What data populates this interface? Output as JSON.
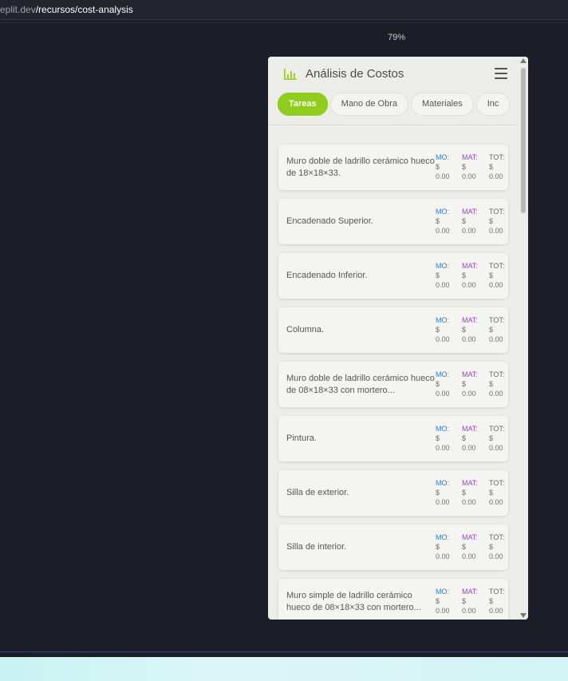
{
  "browser": {
    "url_host": "eplit.dev",
    "url_path": "/recursos/cost-analysis",
    "zoom": "79%"
  },
  "colors": {
    "accent": "#8fcc1c",
    "mo": "#2c7cf0",
    "mat": "#9b3ee0"
  },
  "app": {
    "title": "Análisis de Costos",
    "logo_icon": "bar-chart-icon",
    "menu_icon": "hamburger-menu-icon",
    "tabs": [
      {
        "label": "Tareas",
        "active": true
      },
      {
        "label": "Mano de Obra"
      },
      {
        "label": "Materiales"
      },
      {
        "label": "Inc"
      }
    ]
  },
  "labels": {
    "mo": "MO:",
    "mat": "MAT:",
    "tot": "TOT:",
    "currency": "$"
  },
  "tasks": [
    {
      "name": "Muro doble de ladrillo cerámico hueco de 18×18×33.",
      "mo": "0.00",
      "mat": "0.00",
      "tot": "0.00"
    },
    {
      "name": "Encadenado Superior.",
      "mo": "0.00",
      "mat": "0.00",
      "tot": "0.00"
    },
    {
      "name": "Encadenado Inferior.",
      "mo": "0.00",
      "mat": "0.00",
      "tot": "0.00"
    },
    {
      "name": "Columna.",
      "mo": "0.00",
      "mat": "0.00",
      "tot": "0.00"
    },
    {
      "name": "Muro doble de ladrillo cerámico hueco de 08×18×33 con mortero...",
      "mo": "0.00",
      "mat": "0.00",
      "tot": "0.00"
    },
    {
      "name": "Pintura.",
      "mo": "0.00",
      "mat": "0.00",
      "tot": "0.00"
    },
    {
      "name": "Silla de exterior.",
      "mo": "0.00",
      "mat": "0.00",
      "tot": "0.00"
    },
    {
      "name": "Silla de interior.",
      "mo": "0.00",
      "mat": "0.00",
      "tot": "0.00"
    },
    {
      "name": "Muro simple de ladrillo cerámico hueco de 08×18×33 con mortero...",
      "mo": "0.00",
      "mat": "0.00",
      "tot": "0.00"
    }
  ]
}
